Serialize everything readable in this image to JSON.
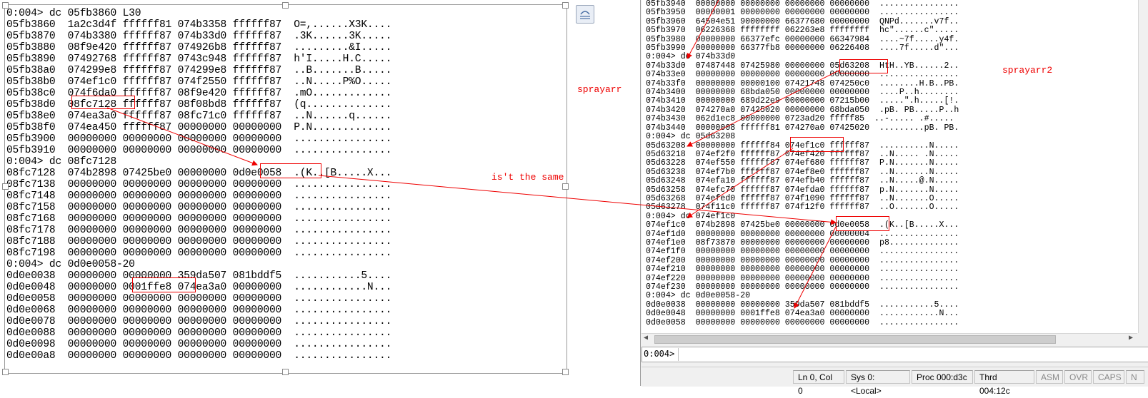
{
  "left": {
    "lines": [
      "0:004> dc 05fb3860 L30",
      "05fb3860  1a2c3d4f ffffff81 074b3358 ffffff87  O=,......X3K....",
      "05fb3870  074b3380 ffffff87 074b33d0 ffffff87  .3K......3K.....",
      "05fb3880  08f9e420 ffffff87 074926b8 ffffff87  .........&I.....",
      "05fb3890  07492768 ffffff87 0743c948 ffffff87  h'I.....H.C.....",
      "05fb38a0  074299e8 ffffff87 074299e8 ffffff87  ..B.......B.....",
      "05fb38b0  074ef1c0 ffffff87 074f2550 ffffff87  ..N.....P%O.....",
      "05fb38c0  074f6da0 ffffff87 08f9e420 ffffff87  .mO.............",
      "05fb38d0  08fc7128 ffffff87 08f08bd8 ffffff87  (q..............",
      "05fb38e0  074ea3a0 ffffff87 08fc71c0 ffffff87  ..N......q......",
      "05fb38f0  074ea450 ffffff87 00000000 00000000  P.N.............",
      "05fb3900  00000000 00000000 00000000 00000000  ................",
      "05fb3910  00000000 00000000 00000000 00000000  ................",
      "0:004> dc 08fc7128",
      "08fc7128  074b2898 07425be0 00000000 0d0e0058  .(K..[B.....X...",
      "08fc7138  00000000 00000000 00000000 00000000  ................",
      "08fc7148  00000000 00000000 00000000 00000000  ................",
      "08fc7158  00000000 00000000 00000000 00000000  ................",
      "08fc7168  00000000 00000000 00000000 00000000  ................",
      "08fc7178  00000000 00000000 00000000 00000000  ................",
      "08fc7188  00000000 00000000 00000000 00000000  ................",
      "08fc7198  00000000 00000000 00000000 00000000  ................",
      "0:004> dc 0d0e0058-20",
      "0d0e0038  00000000 00000000 359da507 081bddf5  ...........5....",
      "0d0e0048  00000000 0001ffe8 074ea3a0 00000000  ............N...",
      "0d0e0058  00000000 00000000 00000000 00000000  ................",
      "0d0e0068  00000000 00000000 00000000 00000000  ................",
      "0d0e0078  00000000 00000000 00000000 00000000  ................",
      "0d0e0088  00000000 00000000 00000000 00000000  ................",
      "0d0e0098  00000000 00000000 00000000 00000000  ................",
      "0d0e00a8  00000000 00000000 00000000 00000000  ................"
    ]
  },
  "right": {
    "lines": [
      "05fb3940  00000000 00000000 00000000 00000000  ................",
      "05fb3950  00000001 00000000 00000000 00000000  ................",
      "05fb3960  64504e51 90000000 66377680 00000000  QNPd.......v7f..",
      "05fb3970  06226368 ffffffff 062263e8 ffffffff  hc\"......c\".....",
      "05fb3980  00000000 66377efc 00000000 66347984  ....~7f.....y4f.",
      "05fb3990  00000000 66377fb8 00000000 06226408  ....7f.....d\"...",
      "0:004> dc 074b33d0",
      "074b33d0  07487448 07425980 00000000 05d63208  HtH..YB......2..",
      "074b33e0  00000000 00000000 00000000 00000000  ................",
      "074b33f0  00000000 00000100 07421748 074250c0  ........H.B..PB.",
      "074b3400  00000000 68bda050 00000000 00000000  ....P..h........",
      "074b3410  00000000 689d22e9 00000000 07215b00  .....\".h.....[!.",
      "074b3420  074270a0 07425020 00000000 68bda050  .pB. PB.....P..h",
      "074b3430  062d1ec8 00000000 0723ad20 fffff85  ..-..... .#.....",
      "074b3440  00000008 ffffff81 074270a0 07425020  .........pB. PB.",
      "0:004> dc 05d63208",
      "05d63208  00000000 ffffff84 074ef1c0 ffffff87  ..........N.....",
      "05d63218  074ef2f0 ffffff87 074ef420 ffffff87  ..N..... .N.....",
      "05d63228  074ef550 ffffff87 074ef680 ffffff87  P.N.......N.....",
      "05d63238  074ef7b0 ffffff87 074ef8e0 ffffff87  ..N.......N.....",
      "05d63248  074efa10 ffffff87 074efb40 ffffff87  ..N.....@.N.....",
      "05d63258  074efc70 ffffff87 074efda0 ffffff87  p.N.......N.....",
      "05d63268  074efed0 ffffff87 074f1090 ffffff87  ..N.......O.....",
      "05d63278  074f11c0 ffffff87 074f12f0 ffffff87  ..O.......O.....",
      "0:004> dc 074ef1c0",
      "074ef1c0  074b2898 07425be0 00000000 0d0e0058  .(K..[B.....X...",
      "074ef1d0  00000000 00000000 00000000 00000004  ................",
      "074ef1e0  08f73870 00000000 00000000 00000000  p8..............",
      "074ef1f0  00000000 00000000 00000000 00000000  ................",
      "074ef200  00000000 00000000 00000000 00000000  ................",
      "074ef210  00000000 00000000 00000000 00000000  ................",
      "074ef220  00000000 00000000 00000000 00000000  ................",
      "074ef230  00000000 00000000 00000000 00000000  ................",
      "0:004> dc 0d0e0058-20",
      "0d0e0038  00000000 00000000 359da507 081bddf5  ...........5....",
      "0d0e0048  00000000 0001ffe8 074ea3a0 00000000  ............N...",
      "0d0e0058  00000000 00000000 00000000 00000000  ................"
    ]
  },
  "annotations": {
    "sprayarr": "sprayarr",
    "sprayarr2": "sprayarr2",
    "same": "is't the same"
  },
  "command": {
    "prompt": "0:004>",
    "value": ""
  },
  "status": {
    "position": "Ln 0, Col 0",
    "sys": "Sys 0:<Local>",
    "proc": "Proc 000:d3c",
    "thrd": "Thrd 004:12c",
    "asm": "ASM",
    "ovr": "OVR",
    "caps": "CAPS",
    "num": "N"
  },
  "icons": {
    "layout_options": "layout-options-icon"
  },
  "colors": {
    "annotation": "#ee0000",
    "status_bg": "#f0f0f0"
  }
}
